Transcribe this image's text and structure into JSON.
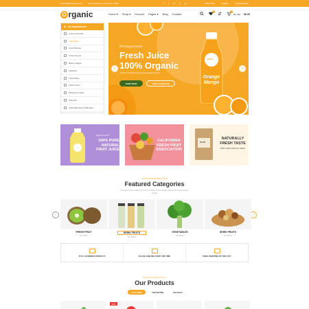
{
  "topbar": {
    "email": "Organic@company.com",
    "shipping": "Free Shipping for all Order of $99",
    "social": [
      "f",
      "t",
      "in",
      "p",
      "g"
    ],
    "currency": "USD Dollar",
    "language": "English",
    "account": "Login/Register"
  },
  "header": {
    "logo_letter": "O",
    "logo_rest": "rganic",
    "nav": [
      "Home",
      "Shop",
      "Product",
      "Pages",
      "Blog",
      "Contact"
    ],
    "cart_label": "My Cart",
    "cart_total": "$0.00",
    "wishlist_count": "0",
    "cart_count": "0"
  },
  "sidebar": {
    "title": "All departments",
    "items": [
      {
        "label": "Fruit & Nut Gifts",
        "arrow": true
      },
      {
        "label": "Vegetables",
        "arrow": true,
        "active": true
      },
      {
        "label": "Fresh Berries",
        "arrow": true
      },
      {
        "label": "Ocean Foods",
        "arrow": false
      },
      {
        "label": "Butter & Eggs",
        "arrow": false
      },
      {
        "label": "Fastfood",
        "arrow": false
      },
      {
        "label": "Fresh Meat",
        "arrow": false
      },
      {
        "label": "Fresh Onion",
        "arrow": false
      },
      {
        "label": "Papaya & Crisps",
        "arrow": false
      },
      {
        "label": "Oatmeal",
        "arrow": false
      },
      {
        "label": "Fresh Bananas & Plantains",
        "arrow": false
      }
    ]
  },
  "hero": {
    "script": "Pomegranate",
    "title1": "Fresh Juice",
    "title2": "100% Organic",
    "subtitle": "A blend of freshly squeezed Orange & Fruits",
    "btn_primary": "SHOP NOW",
    "btn_secondary": "VIEW LOOKBOOK",
    "bottle_label": "JUICE",
    "bottle_text": "Orange Mango"
  },
  "banners": [
    {
      "small": "Season Fresh",
      "big": "100% PURE NATURAL FRUIT JUICE"
    },
    {
      "small": "",
      "big": "CALIFORNIA FRESH FRUIT ASSOCIATION"
    },
    {
      "small": "",
      "big": "NATURALLY FRESH TASTE",
      "line": "WITH 25% OFF ALL TEAS",
      "pack": "PACK"
    }
  ],
  "featured": {
    "kicker": "SHOP CATEGORIES NOW",
    "title": "Featured Categories",
    "subtitle": "Curated food is taken from the world's most modern farms with strict safety codes",
    "categories": [
      {
        "name": "FRESH FRUIT",
        "link": "Go Shop"
      },
      {
        "name": "DRINK FRUITS",
        "link": "Go Shop"
      },
      {
        "name": "VEGETABLES",
        "link": "Go Shop"
      },
      {
        "name": "DRIED FRUITS",
        "link": "Go Shop"
      }
    ]
  },
  "features": [
    {
      "label": "FULL STAMPED PRODUCT"
    },
    {
      "label": "PLACE AND DELIVERY ON TIME"
    },
    {
      "label": "FREE SHIPPING IN THE CITY"
    }
  ],
  "products": {
    "kicker": "All the best items for You",
    "title": "Our Products",
    "tabs": [
      "FEATURED",
      "TOP RATED",
      "ON SALE"
    ],
    "badge": "-50%"
  },
  "colors": {
    "accent": "#f5a623",
    "dark_green": "#3b6b1f",
    "banner_purple": "#b08fd9",
    "banner_pink": "#f2909b",
    "banner_cream": "#fff5e4"
  }
}
